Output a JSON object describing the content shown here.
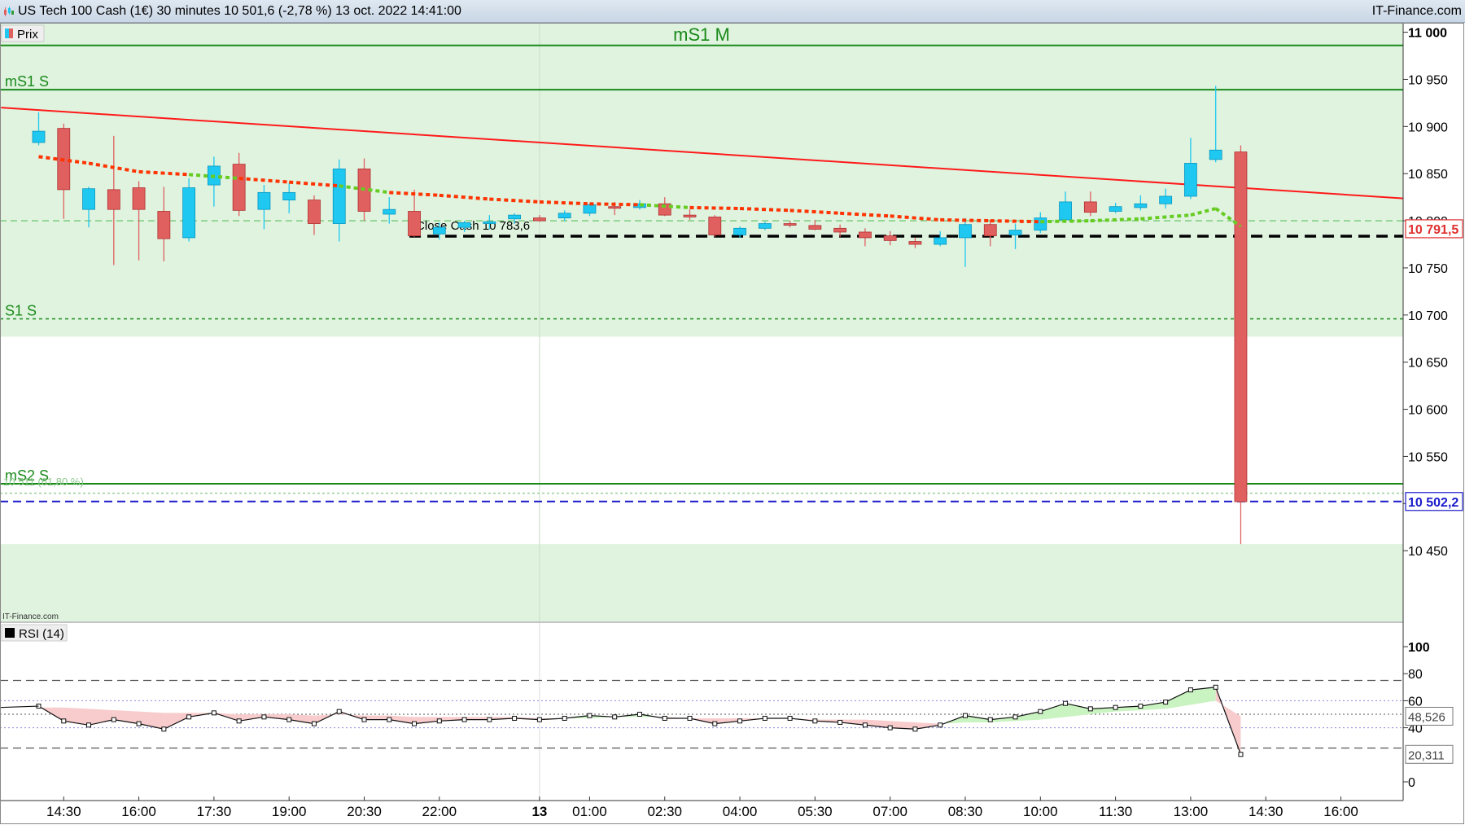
{
  "header": {
    "title": "US Tech 100 Cash (1€) 30 minutes 10 501,6 (-2,78 %) 13 oct. 2022 14:41:00",
    "brand": "IT-Finance.com"
  },
  "colors": {
    "up": "#1ec8f0",
    "down": "#e06060",
    "zone": "#dff3df",
    "level_green": "#1a8a1a",
    "trendline": "#ff1a1a",
    "ma_red": "#ff3300",
    "ma_green": "#66cc22",
    "close_line": "#000000",
    "last_price": "#1a1acc",
    "rsi_line": "#111111"
  },
  "chart_data": [
    {
      "type": "candlestick",
      "legend": "Prix",
      "ylim": [
        10375,
        11010
      ],
      "y_ticks": [
        {
          "v": 11000,
          "label": "11 000"
        },
        {
          "v": 10950,
          "label": "10 950"
        },
        {
          "v": 10900,
          "label": "10 900"
        },
        {
          "v": 10850,
          "label": "10 850"
        },
        {
          "v": 10800,
          "label": "10 800"
        },
        {
          "v": 10750,
          "label": "10 750"
        },
        {
          "v": 10700,
          "label": "10 700"
        },
        {
          "v": 10650,
          "label": "10 650"
        },
        {
          "v": 10600,
          "label": "10 600"
        },
        {
          "v": 10550,
          "label": "10 550"
        },
        {
          "v": 10500,
          "label": "10 500"
        },
        {
          "v": 10450,
          "label": "10 450"
        }
      ],
      "x_ticks": [
        {
          "i": 1,
          "label": "14:30"
        },
        {
          "i": 4,
          "label": "16:00"
        },
        {
          "i": 7,
          "label": "17:30"
        },
        {
          "i": 10,
          "label": "19:00"
        },
        {
          "i": 13,
          "label": "20:30"
        },
        {
          "i": 16,
          "label": "22:00"
        },
        {
          "i": 20,
          "label": "13",
          "bold": true
        },
        {
          "i": 22,
          "label": "01:00"
        },
        {
          "i": 25,
          "label": "02:30"
        },
        {
          "i": 28,
          "label": "04:00"
        },
        {
          "i": 31,
          "label": "05:30"
        },
        {
          "i": 34,
          "label": "07:00"
        },
        {
          "i": 37,
          "label": "08:30"
        },
        {
          "i": 40,
          "label": "10:00"
        },
        {
          "i": 43,
          "label": "11:30"
        },
        {
          "i": 46,
          "label": "13:00"
        },
        {
          "i": 49,
          "label": "14:30"
        },
        {
          "i": 52,
          "label": "16:00"
        }
      ],
      "ohlc": [
        [
          10883,
          10915,
          10880,
          10895
        ],
        [
          10898,
          10903,
          10802,
          10833
        ],
        [
          10812,
          10836,
          10793,
          10834
        ],
        [
          10833,
          10890,
          10753,
          10812
        ],
        [
          10835,
          10842,
          10758,
          10812
        ],
        [
          10810,
          10836,
          10757,
          10781
        ],
        [
          10782,
          10845,
          10778,
          10835
        ],
        [
          10838,
          10868,
          10815,
          10858
        ],
        [
          10860,
          10872,
          10805,
          10811
        ],
        [
          10812,
          10838,
          10791,
          10830
        ],
        [
          10822,
          10840,
          10808,
          10830
        ],
        [
          10822,
          10827,
          10785,
          10797
        ],
        [
          10797,
          10865,
          10778,
          10855
        ],
        [
          10855,
          10866,
          10800,
          10810
        ],
        [
          10807,
          10825,
          10797,
          10812
        ],
        [
          10810,
          10833,
          10783,
          10784
        ],
        [
          10786,
          10798,
          10780,
          10793
        ],
        [
          10793,
          10800,
          10788,
          10798
        ],
        [
          10797,
          10806,
          10791,
          10799
        ],
        [
          10802,
          10808,
          10797,
          10806
        ],
        [
          10803,
          10806,
          10799,
          10800
        ],
        [
          10803,
          10811,
          10800,
          10808
        ],
        [
          10808,
          10818,
          10805,
          10817
        ],
        [
          10815,
          10820,
          10806,
          10814
        ],
        [
          10814,
          10822,
          10812,
          10818
        ],
        [
          10818,
          10825,
          10805,
          10806
        ],
        [
          10806,
          10812,
          10801,
          10804
        ],
        [
          10804,
          10806,
          10783,
          10785
        ],
        [
          10785,
          10794,
          10782,
          10792
        ],
        [
          10792,
          10799,
          10790,
          10797
        ],
        [
          10797,
          10800,
          10793,
          10796
        ],
        [
          10795,
          10801,
          10790,
          10791
        ],
        [
          10792,
          10796,
          10783,
          10788
        ],
        [
          10788,
          10792,
          10773,
          10782
        ],
        [
          10784,
          10789,
          10774,
          10779
        ],
        [
          10778,
          10782,
          10771,
          10775
        ],
        [
          10775,
          10789,
          10773,
          10782
        ],
        [
          10782,
          10803,
          10751,
          10796
        ],
        [
          10796,
          10801,
          10773,
          10784
        ],
        [
          10785,
          10797,
          10770,
          10790
        ],
        [
          10790,
          10809,
          10787,
          10803
        ],
        [
          10801,
          10831,
          10798,
          10820
        ],
        [
          10820,
          10831,
          10805,
          10809
        ],
        [
          10810,
          10819,
          10808,
          10815
        ],
        [
          10814,
          10827,
          10811,
          10818
        ],
        [
          10818,
          10834,
          10813,
          10826
        ],
        [
          10826,
          10888,
          10823,
          10861
        ],
        [
          10865,
          10943,
          10862,
          10875
        ],
        [
          10873,
          10880,
          10457,
          10502
        ]
      ],
      "moving_average": [
        {
          "i": 0,
          "v": 10868
        },
        {
          "i": 2,
          "v": 10861
        },
        {
          "i": 4,
          "v": 10852
        },
        {
          "i": 6,
          "v": 10849
        },
        {
          "i": 8,
          "v": 10845
        },
        {
          "i": 10,
          "v": 10841
        },
        {
          "i": 12,
          "v": 10837
        },
        {
          "i": 14,
          "v": 10830
        },
        {
          "i": 16,
          "v": 10827
        },
        {
          "i": 18,
          "v": 10823
        },
        {
          "i": 20,
          "v": 10820
        },
        {
          "i": 22,
          "v": 10818
        },
        {
          "i": 24,
          "v": 10817
        },
        {
          "i": 26,
          "v": 10814
        },
        {
          "i": 28,
          "v": 10813
        },
        {
          "i": 30,
          "v": 10811
        },
        {
          "i": 32,
          "v": 10808
        },
        {
          "i": 34,
          "v": 10805
        },
        {
          "i": 36,
          "v": 10801
        },
        {
          "i": 38,
          "v": 10800
        },
        {
          "i": 40,
          "v": 10799
        },
        {
          "i": 42,
          "v": 10800
        },
        {
          "i": 44,
          "v": 10802
        },
        {
          "i": 46,
          "v": 10806
        },
        {
          "i": 47,
          "v": 10813
        },
        {
          "i": 48,
          "v": 10794
        }
      ],
      "zones": [
        {
          "from": 10677,
          "to": 11010
        },
        {
          "from": 10375,
          "to": 10457
        }
      ],
      "levels": [
        {
          "name": "mS1 M",
          "value": 10986,
          "style": "solid",
          "label_pos": "center"
        },
        {
          "name": "mS1 S",
          "value": 10939,
          "style": "solid",
          "label_pos": "left"
        },
        {
          "name": "S1 S",
          "value": 10696,
          "style": "dotted",
          "label_pos": "left"
        },
        {
          "name": "mS2 S",
          "value": 10521,
          "style": "solid",
          "label_pos": "left"
        }
      ],
      "fib_level": {
        "label": "10 511 (61,80 %)",
        "value": 10511
      },
      "pivot_level": {
        "value": 10800
      },
      "trendline": {
        "from": {
          "i": -1.5,
          "v": 10920
        },
        "to": {
          "i": 55.5,
          "v": 10822
        }
      },
      "close_cash": {
        "label": "Close Cash 10 783,6",
        "value": 10783.6,
        "from_i": 15
      },
      "price_tags": [
        {
          "label": "10 791,5",
          "value": 10791.5,
          "color": "#e03030"
        },
        {
          "label": "10 502,2",
          "value": 10502.2,
          "color": "#1a1acc"
        }
      ],
      "last_price": 10502.2,
      "watermark": "IT-Finance.com"
    },
    {
      "type": "line",
      "legend": "RSI (14)",
      "ylim": [
        0,
        105
      ],
      "y_ticks": [
        100,
        80,
        60,
        40,
        0
      ],
      "levels": [
        75,
        25
      ],
      "midline": 50,
      "signal_band": [
        60,
        40
      ],
      "values": [
        56,
        45,
        42,
        46,
        43,
        39,
        48,
        51,
        45,
        48,
        46,
        43,
        52,
        46,
        46,
        43,
        45,
        46,
        46,
        47,
        46,
        47,
        49,
        48,
        50,
        47,
        47,
        43,
        45,
        47,
        47,
        45,
        44,
        42,
        40,
        39,
        42,
        49,
        46,
        48,
        52,
        58,
        54,
        55,
        56,
        59,
        68,
        70,
        20.3
      ],
      "signal": [
        55,
        55,
        54,
        53,
        52,
        51,
        51,
        51,
        50,
        50,
        50,
        49,
        50,
        49,
        49,
        48,
        48,
        48,
        48,
        48,
        47,
        47,
        47,
        48,
        48,
        48,
        47,
        47,
        47,
        47,
        47,
        46,
        46,
        46,
        45,
        44,
        43,
        44,
        44,
        45,
        46,
        48,
        50,
        52,
        53,
        54,
        57,
        60,
        48.5
      ],
      "value_tags": [
        {
          "label": "48,526",
          "value": 48.526
        },
        {
          "label": "20,311",
          "value": 20.311
        }
      ]
    }
  ]
}
